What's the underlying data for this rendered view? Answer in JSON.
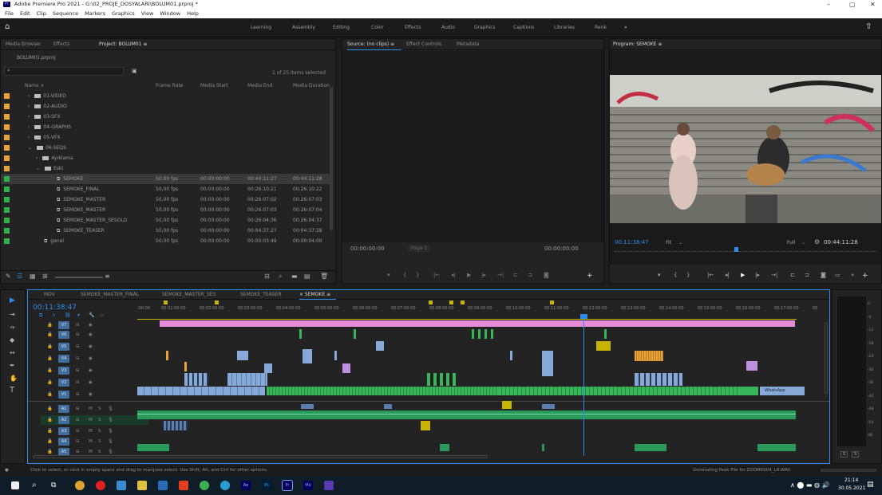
{
  "window": {
    "title": "Adobe Premiere Pro 2021 - G:\\02_PROJE_DOSYALARI\\BOLUM01.prproj *",
    "app_icon": "Pr",
    "controls": [
      "–",
      "▢",
      "✕"
    ]
  },
  "menu": [
    "File",
    "Edit",
    "Clip",
    "Sequence",
    "Markers",
    "Graphics",
    "View",
    "Window",
    "Help"
  ],
  "workspaces": [
    "Learning",
    "Assembly",
    "Editing",
    "Color",
    "Effects",
    "Audio",
    "Graphics",
    "Captions",
    "Libraries",
    "Renk",
    "»"
  ],
  "project": {
    "tabs": [
      "Media Browser",
      "Effects",
      "Project: BOLUM01 ≡"
    ],
    "file": "BOLUM01.prproj",
    "items_status": "1 of 25 items selected",
    "columns": [
      "Name ∧",
      "Frame Rate",
      "Media Start",
      "Media End",
      "Media Duration"
    ],
    "folders": [
      {
        "name": "01-VIDEO",
        "color": "#e8a23a"
      },
      {
        "name": "02-AUDIO",
        "color": "#e8a23a"
      },
      {
        "name": "03-SFX",
        "color": "#e8a23a"
      },
      {
        "name": "04-GRAPHS",
        "color": "#e8a23a"
      },
      {
        "name": "05-VFX",
        "color": "#e8a23a"
      },
      {
        "name": "06-SEQS",
        "color": "#e8a23a"
      },
      {
        "name": "Ayıklama",
        "color": "#e8a23a"
      },
      {
        "name": "Eski",
        "color": "#e8a23a"
      }
    ],
    "sequences": [
      {
        "name": "SEMOKE",
        "fps": "50,00 fps",
        "start": "00:00:00:00",
        "end": "00:44:11:27",
        "dur": "00:44:11:28"
      },
      {
        "name": "SEMOKE_FINAL",
        "fps": "50,00 fps",
        "start": "00:00:00:00",
        "end": "00:26:10:21",
        "dur": "00:26:10:22"
      },
      {
        "name": "SEMOKE_MASTER",
        "fps": "50,00 fps",
        "start": "00:00:00:00",
        "end": "00:26:07:02",
        "dur": "00:26:07:03"
      },
      {
        "name": "SEMOKE_MASTER",
        "fps": "50,00 fps",
        "start": "00:00:00:00",
        "end": "00:26:07:03",
        "dur": "00:26:07:04"
      },
      {
        "name": "SEMOKE_MASTER_SESOLD",
        "fps": "50,00 fps",
        "start": "00:00:00:00",
        "end": "00:26:04:36",
        "dur": "00:26:04:37"
      },
      {
        "name": "SEMOKE_TEASER",
        "fps": "50,00 fps",
        "start": "00:00:00:00",
        "end": "00:04:37:27",
        "dur": "00:04:37:28"
      },
      {
        "name": "genel",
        "fps": "50,00 fps",
        "start": "00:00:00:00",
        "end": "00:00:03:49",
        "dur": "00:00:04:00"
      }
    ]
  },
  "source": {
    "tabs": [
      "Source: (no clips) ≡",
      "Effect Controls",
      "Metadata"
    ],
    "tc_left": "00:00:00:00",
    "tc_right": "00:00:00:00",
    "page": "Page 1"
  },
  "program": {
    "tab": "Program: SEMOKE ≡",
    "tc": "00:11:38:47",
    "fit": "Fit",
    "quality": "Full",
    "duration": "00:44:11:28"
  },
  "timeline": {
    "tabs": [
      "MOV",
      "SEMOKE_MASTER_FINAL",
      "SEMOKE_MASTER_SES",
      "SEMOKE_TEASER",
      "× SEMOKE ≡"
    ],
    "tc": "00:11:38:47",
    "ruler": [
      ":00:00",
      "00:01:00:00",
      "00:02:00:00",
      "00:03:00:00",
      "00:04:00:00",
      "00:05:00:00",
      "00:06:00:00",
      "00:07:00:00",
      "00:08:00:00",
      "00:09:00:00",
      "00:10:00:00",
      "00:11:00:00",
      "00:12:00:00",
      "00:13:00:00",
      "00:14:00:00",
      "00:15:00:00",
      "00:16:00:00",
      "00:17:00:00",
      "00"
    ],
    "vtracks": [
      "V7",
      "V6",
      "V5",
      "V4",
      "V3",
      "V2",
      "V1"
    ],
    "atracks": [
      "A1",
      "A2",
      "A3",
      "A4",
      "A5"
    ],
    "clip_label": "WhatsApp"
  },
  "meter_scale": [
    "0",
    "-6",
    "-12",
    "-18",
    "-24",
    "-30",
    "-36",
    "-42",
    "-48",
    "-54",
    "dB"
  ],
  "meter_solo": [
    "S",
    "S"
  ],
  "status": {
    "left": "Click to select, or click in empty space and drag to marquee select. Use Shift, Alt, and Ctrl for other options.",
    "right": "Generating Peak File for ZOOM0004_LR.WAV"
  },
  "taskbar": {
    "time": "21:14",
    "date": "30.05.2021",
    "apps": [
      "Ae",
      "Ps",
      "Pr",
      "Me"
    ]
  },
  "colors": {
    "accent": "#2d8ceb",
    "pink": "#e58bd8",
    "green": "#38b45a",
    "blue": "#86a9d8"
  }
}
